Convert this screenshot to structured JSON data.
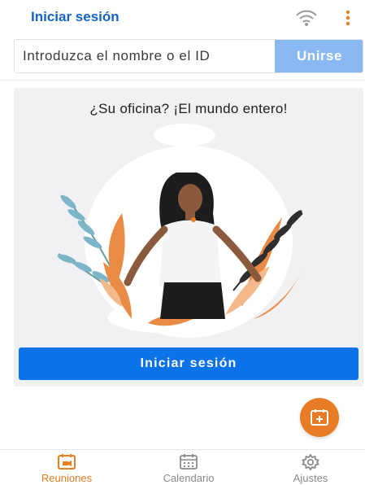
{
  "header": {
    "title": "Iniciar sesión",
    "wifi_icon": "wifi-signal-icon",
    "menu_icon": "more-vertical-icon"
  },
  "join": {
    "placeholder": "Introduzca el nombre o el ID",
    "button_label": "Unirse"
  },
  "promo": {
    "headline": "¿Su oficina? ¡El mundo entero!",
    "illustration": "woman-with-plants-illustration",
    "signin_label": "Iniciar sesión"
  },
  "fab": {
    "icon": "calendar-add-icon"
  },
  "tabs": [
    {
      "label": "Reuniones",
      "icon": "meetings-icon",
      "active": true
    },
    {
      "label": "Calendario",
      "icon": "calendar-icon",
      "active": false
    },
    {
      "label": "Ajustes",
      "icon": "settings-gear-icon",
      "active": false
    }
  ],
  "colors": {
    "brand_blue": "#1565c0",
    "primary_button": "#0b72e8",
    "join_button": "#8ab8f2",
    "accent_orange": "#e77b26"
  }
}
